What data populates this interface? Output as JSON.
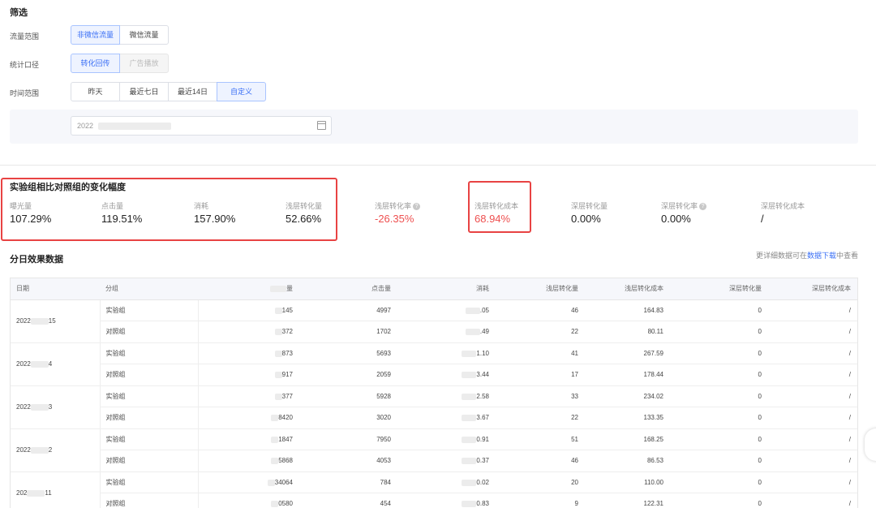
{
  "filter": {
    "title": "筛选",
    "traffic": {
      "label": "流量范围",
      "options": [
        "非微信流量",
        "微信流量"
      ],
      "selected": 0
    },
    "stat": {
      "label": "统计口径",
      "options": [
        "转化回传",
        "广告播放"
      ],
      "selected": 0
    },
    "time": {
      "label": "时间范围",
      "options": [
        "昨天",
        "最近七日",
        "最近14日",
        "自定义"
      ],
      "selected": 3
    },
    "date_prefix": "2022"
  },
  "summary": {
    "title": "实验组相比对照组的变化幅度",
    "metrics": [
      {
        "label": "曝光量",
        "value": "107.29%"
      },
      {
        "label": "点击量",
        "value": "119.51%"
      },
      {
        "label": "消耗",
        "value": "157.90%"
      },
      {
        "label": "浅层转化量",
        "value": "52.66%"
      },
      {
        "label": "浅层转化率",
        "value": "-26.35%",
        "help": true
      },
      {
        "label": "浅层转化成本",
        "value": "68.94%"
      },
      {
        "label": "深层转化量",
        "value": "0.00%"
      },
      {
        "label": "深层转化率",
        "value": "0.00%",
        "help": true
      },
      {
        "label": "深层转化成本",
        "value": "/"
      }
    ],
    "negative_color": "#ee5050",
    "highlight_color": "#e84343"
  },
  "daily": {
    "title": "分日效果数据",
    "hint_before": "更详细数据可在",
    "hint_link": "数据下载",
    "hint_after": "中查看",
    "headers": [
      "日期",
      "分组",
      "量",
      "点击量",
      "消耗",
      "浅层转化量",
      "浅层转化成本",
      "深层转化量",
      "深层转化成本"
    ],
    "rows": [
      {
        "date": "2022",
        "date_tail": "15",
        "group": "实验组",
        "exposure": "145",
        "clicks": "4997",
        "cost": ".05",
        "shallow": "46",
        "shallow_cost": "164.83",
        "deep": "0",
        "deep_cost": "/"
      },
      {
        "group": "对照组",
        "exposure": "372",
        "clicks": "1702",
        "cost": ".49",
        "shallow": "22",
        "shallow_cost": "80.11",
        "deep": "0",
        "deep_cost": "/"
      },
      {
        "date": "2022",
        "date_tail": "4",
        "group": "实验组",
        "exposure": "873",
        "clicks": "5693",
        "cost": "1.10",
        "shallow": "41",
        "shallow_cost": "267.59",
        "deep": "0",
        "deep_cost": "/"
      },
      {
        "group": "对照组",
        "exposure": "917",
        "clicks": "2059",
        "cost": "3.44",
        "shallow": "17",
        "shallow_cost": "178.44",
        "deep": "0",
        "deep_cost": "/"
      },
      {
        "date": "2022",
        "date_tail": "3",
        "group": "实验组",
        "exposure": "377",
        "clicks": "5928",
        "cost": "2.58",
        "shallow": "33",
        "shallow_cost": "234.02",
        "deep": "0",
        "deep_cost": "/"
      },
      {
        "group": "对照组",
        "exposure": "8420",
        "clicks": "3020",
        "cost": "3.67",
        "shallow": "22",
        "shallow_cost": "133.35",
        "deep": "0",
        "deep_cost": "/"
      },
      {
        "date": "2022",
        "date_tail": "2",
        "group": "实验组",
        "exposure": "1847",
        "clicks": "7950",
        "cost": "0.91",
        "shallow": "51",
        "shallow_cost": "168.25",
        "deep": "0",
        "deep_cost": "/"
      },
      {
        "group": "对照组",
        "exposure": "5868",
        "clicks": "4053",
        "cost": "0.37",
        "shallow": "46",
        "shallow_cost": "86.53",
        "deep": "0",
        "deep_cost": "/"
      },
      {
        "date": "202",
        "date_tail": "11",
        "group": "实验组",
        "exposure": "34064",
        "clicks": "784",
        "cost": "0.02",
        "shallow": "20",
        "shallow_cost": "110.00",
        "deep": "0",
        "deep_cost": "/"
      },
      {
        "group": "对照组",
        "exposure": "0580",
        "clicks": "454",
        "cost": "0.83",
        "shallow": "9",
        "shallow_cost": "122.31",
        "deep": "0",
        "deep_cost": "/"
      }
    ]
  }
}
